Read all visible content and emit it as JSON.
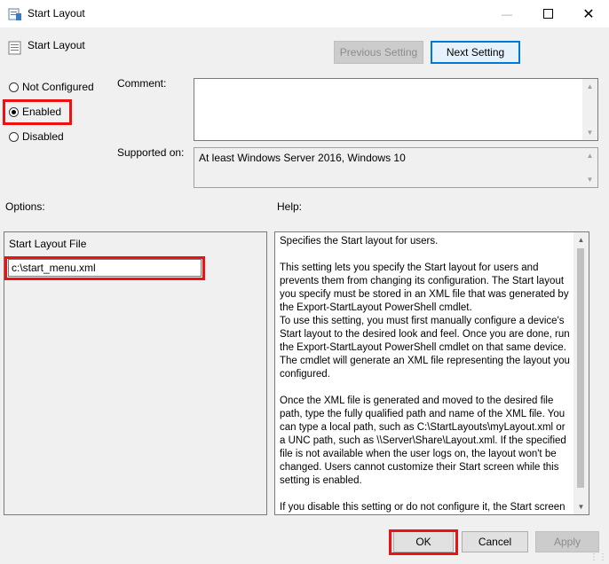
{
  "window": {
    "title": "Start Layout",
    "controls": {
      "minimize_icon": "minimize-icon",
      "maximize_icon": "maximize-icon",
      "close_icon": "close-icon"
    }
  },
  "header": {
    "title": "Start Layout",
    "previous_label": "Previous Setting",
    "next_label": "Next Setting"
  },
  "state": {
    "options": [
      {
        "label": "Not Configured",
        "checked": false
      },
      {
        "label": "Enabled",
        "checked": true
      },
      {
        "label": "Disabled",
        "checked": false
      }
    ]
  },
  "comment": {
    "label": "Comment:",
    "value": ""
  },
  "supported": {
    "label": "Supported on:",
    "value": "At least Windows Server 2016, Windows 10"
  },
  "options_section": {
    "label": "Options:",
    "field_label": "Start Layout File",
    "field_value": "c:\\start_menu.xml"
  },
  "help_section": {
    "label": "Help:",
    "paragraphs": [
      "Specifies the Start layout for users.",
      "This setting lets you specify the Start layout for users and prevents them from changing its configuration. The Start layout you specify must be stored in an XML file that was generated by the Export-StartLayout PowerShell cmdlet.\nTo use this setting, you must first manually configure a device's Start layout to the desired look and feel. Once you are done, run the Export-StartLayout PowerShell cmdlet on that same device. The cmdlet will generate an XML file representing the layout you configured.",
      "Once the XML file is generated and moved to the desired file path, type the fully qualified path and name of the XML file. You can type a local path, such as C:\\StartLayouts\\myLayout.xml or a UNC path, such as \\\\Server\\Share\\Layout.xml. If the specified file is not available when the user logs on, the layout won't be changed. Users cannot customize their Start screen while this setting is enabled.",
      "If you disable this setting or do not configure it, the Start screen layout won't be changed and users will be able to customize it."
    ]
  },
  "buttons": {
    "ok": "OK",
    "cancel": "Cancel",
    "apply": "Apply"
  },
  "colors": {
    "highlight": "#ee1111",
    "accent": "#0078d7"
  }
}
